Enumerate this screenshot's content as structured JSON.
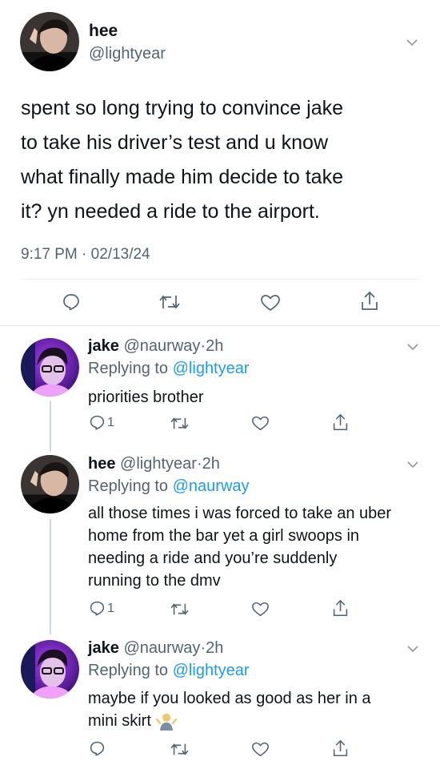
{
  "main_tweet": {
    "display_name": "hee",
    "handle": "@lightyear",
    "text_lines": [
      "spent so long trying to convince jake",
      "to take his driver’s test and u know",
      "what finally made him decide to take",
      "it? yn needed a ride to the airport."
    ],
    "time": "9:17 PM",
    "separator": "·",
    "date": "02/13/24"
  },
  "replies": [
    {
      "display_name": "jake",
      "handle": "@naurway",
      "dot": "·",
      "age": "2h",
      "replying_prefix": "Replying to",
      "replying_handle": "@lightyear",
      "text_lines": [
        "priorities brother"
      ],
      "reply_count": "1",
      "avatar": "purple-neon"
    },
    {
      "display_name": "hee",
      "handle": "@lightyear",
      "dot": "·",
      "age": "2h",
      "replying_prefix": "Replying to",
      "replying_handle": "@naurway",
      "text_lines": [
        "all those times i was forced to take an uber",
        "home from the bar yet a girl swoops in",
        "needing a ride and you’re suddenly",
        "running to the dmv"
      ],
      "reply_count": "1",
      "avatar": "dark"
    },
    {
      "display_name": "jake",
      "handle": "@naurway",
      "dot": "·",
      "age": "2h",
      "replying_prefix": "Replying to",
      "replying_handle": "@lightyear",
      "text_lines": [
        "maybe if you looked as good as her in a",
        "mini skirt"
      ],
      "emoji": "person-shrugging",
      "reply_count": "",
      "avatar": "purple-neon"
    }
  ],
  "colors": {
    "accent": "#1d9bf0",
    "muted": "#536471",
    "text": "#0f1419",
    "divider": "#eff3f4"
  }
}
